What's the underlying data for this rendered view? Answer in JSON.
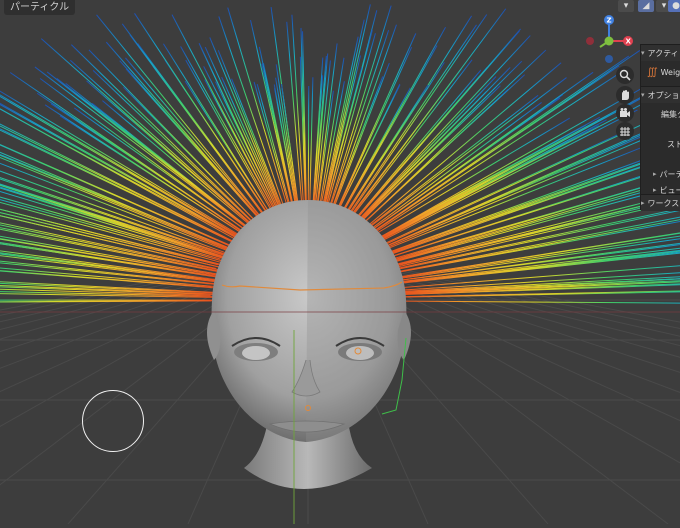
{
  "header": {
    "mode_label": "パーティクル"
  },
  "sidebar": {
    "active_tool_header": "アクティ",
    "tool_name": "Weig",
    "options_header": "オプショ",
    "edit_label": "編集タ",
    "stroke_label": "スト",
    "particle_label": "パーテ",
    "viewport_label": "ビュー",
    "workspace_label": "ワークス"
  },
  "gizmo": {
    "z": "Z",
    "x": "X",
    "y": "Y"
  },
  "colors": {
    "x_axis": "#e0404f",
    "y_axis": "#7fbf3f",
    "z_axis": "#3f7fdf",
    "bg": "#3d3d3d",
    "head": "#a3a3a3"
  },
  "icons": [
    "zoom-icon",
    "hand-pan-icon",
    "camera-icon",
    "grid-ortho-icon"
  ]
}
